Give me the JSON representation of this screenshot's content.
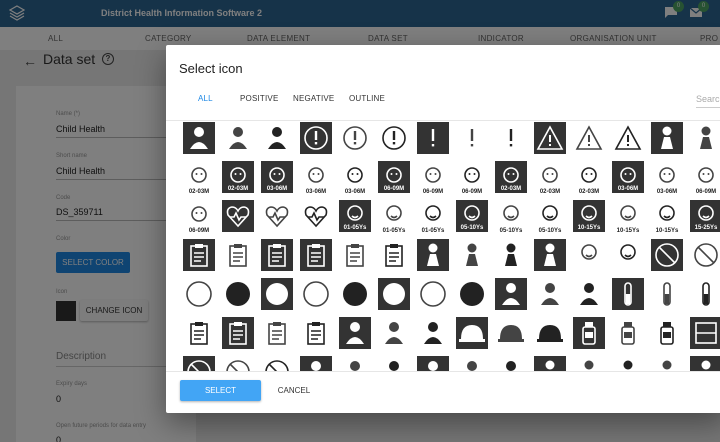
{
  "header": {
    "app_title": "District Health Information Software 2",
    "messages_badge": "0",
    "mail_badge": "0"
  },
  "nav": {
    "tabs": [
      "ALL",
      "CATEGORY",
      "DATA ELEMENT",
      "DATA SET",
      "INDICATOR",
      "ORGANISATION UNIT",
      "PRO"
    ]
  },
  "page": {
    "title": "Data set",
    "name_label": "Name (*)",
    "name_value": "Child Health",
    "short_name_label": "Short name",
    "short_name_value": "Child Health",
    "code_label": "Code",
    "code_value": "DS_359711",
    "color_label": "Color",
    "select_color_button": "SELECT COLOR",
    "icon_label": "Icon",
    "change_icon_button": "CHANGE ICON",
    "description_placeholder": "Description",
    "expiry_label": "Expiry days",
    "expiry_value": "0",
    "open_future_label": "Open future periods for data entry",
    "open_future_value": "0"
  },
  "dialog": {
    "title": "Select icon",
    "tabs": [
      {
        "label": "ALL",
        "active": true
      },
      {
        "label": "POSITIVE",
        "active": false
      },
      {
        "label": "NEGATIVE",
        "active": false
      },
      {
        "label": "OUTLINE",
        "active": false
      }
    ],
    "search_placeholder": "Search",
    "select_button": "SELECT",
    "cancel_button": "CANCEL",
    "icon_rows": [
      [
        {
          "name": "farmer-icon",
          "style": "dark",
          "glyph": "person"
        },
        {
          "name": "farmer-outline-icon",
          "style": "outline",
          "glyph": "person"
        },
        {
          "name": "farmer-positive-icon",
          "style": "plain",
          "glyph": "person"
        },
        {
          "name": "exclamation-circle-dark-icon",
          "style": "dark",
          "glyph": "excl-circle"
        },
        {
          "name": "exclamation-circle-outline-icon",
          "style": "outline",
          "glyph": "excl-circle"
        },
        {
          "name": "exclamation-circle-icon",
          "style": "plain",
          "glyph": "excl-circle"
        },
        {
          "name": "exclamation-dark-icon",
          "style": "dark",
          "glyph": "excl"
        },
        {
          "name": "exclamation-outline-icon",
          "style": "outline",
          "glyph": "excl"
        },
        {
          "name": "exclamation-icon",
          "style": "plain",
          "glyph": "excl"
        },
        {
          "name": "warning-dark-icon",
          "style": "dark",
          "glyph": "triangle"
        },
        {
          "name": "warning-outline-icon",
          "style": "outline",
          "glyph": "triangle"
        },
        {
          "name": "warning-icon",
          "style": "plain",
          "glyph": "triangle"
        },
        {
          "name": "pregnant-dark-icon",
          "style": "dark",
          "glyph": "woman"
        },
        {
          "name": "pregnant-outline-icon",
          "style": "outline",
          "glyph": "woman"
        }
      ],
      [
        {
          "name": "baby-02-03m-icon",
          "style": "outline",
          "glyph": "baby",
          "label": "02-03M"
        },
        {
          "name": "baby-02-03m-dark-icon",
          "style": "dark",
          "glyph": "baby",
          "label": "02-03M"
        },
        {
          "name": "baby-03-06m-dark-icon",
          "style": "dark",
          "glyph": "baby",
          "label": "03-06M"
        },
        {
          "name": "baby-03-06m-icon",
          "style": "outline",
          "glyph": "baby",
          "label": "03-06M"
        },
        {
          "name": "baby-03-06m-positive-icon",
          "style": "plain",
          "glyph": "baby",
          "label": "03-06M"
        },
        {
          "name": "baby-06-09m-dark-icon",
          "style": "dark",
          "glyph": "baby",
          "label": "06-09M"
        },
        {
          "name": "baby-06-09m-icon",
          "style": "outline",
          "glyph": "baby",
          "label": "06-09M"
        },
        {
          "name": "baby-06-09m-positive-icon",
          "style": "plain",
          "glyph": "baby",
          "label": "06-09M"
        },
        {
          "name": "baby-02-03m-dark-2-icon",
          "style": "dark",
          "glyph": "baby",
          "label": "02-03M"
        },
        {
          "name": "baby-02-03m-outline-2-icon",
          "style": "outline",
          "glyph": "baby",
          "label": "02-03M"
        },
        {
          "name": "baby-02-03m-positive-2-icon",
          "style": "plain",
          "glyph": "baby",
          "label": "02-03M"
        },
        {
          "name": "baby-03-06m-dark-2-icon",
          "style": "dark",
          "glyph": "baby",
          "label": "03-06M"
        },
        {
          "name": "baby-03-06m-outline-2-icon",
          "style": "outline",
          "glyph": "baby",
          "label": "03-06M"
        },
        {
          "name": "baby-06-09m-outline-2-icon",
          "style": "outline",
          "glyph": "baby",
          "label": "06-09M"
        }
      ],
      [
        {
          "name": "baby-06-09m-outline-3-icon",
          "style": "outline",
          "glyph": "baby",
          "label": "06-09M"
        },
        {
          "name": "heart-pulse-dark-icon",
          "style": "dark",
          "glyph": "heart"
        },
        {
          "name": "heart-check-outline-icon",
          "style": "outline",
          "glyph": "heart"
        },
        {
          "name": "heart-check-icon",
          "style": "plain",
          "glyph": "heart"
        },
        {
          "name": "child-01-05y-dark-icon",
          "style": "dark",
          "glyph": "child",
          "label": "01-05Ys"
        },
        {
          "name": "child-01-05y-icon",
          "style": "outline",
          "glyph": "child",
          "label": "01-05Ys"
        },
        {
          "name": "child-01-05y-positive-icon",
          "style": "plain",
          "glyph": "child",
          "label": "01-05Ys"
        },
        {
          "name": "child-05-10y-dark-icon",
          "style": "dark",
          "glyph": "child",
          "label": "05-10Ys"
        },
        {
          "name": "child-05-10y-icon",
          "style": "outline",
          "glyph": "child",
          "label": "05-10Ys"
        },
        {
          "name": "child-05-10y-positive-icon",
          "style": "plain",
          "glyph": "child",
          "label": "05-10Ys"
        },
        {
          "name": "child-10-15y-dark-icon",
          "style": "dark",
          "glyph": "child",
          "label": "10-15Ys"
        },
        {
          "name": "child-10-15y-icon",
          "style": "outline",
          "glyph": "child",
          "label": "10-15Ys"
        },
        {
          "name": "child-10-15y-positive-icon",
          "style": "plain",
          "glyph": "child",
          "label": "10-15Ys"
        },
        {
          "name": "child-15-25y-dark-icon",
          "style": "dark",
          "glyph": "child",
          "label": "15-25Ys"
        }
      ],
      [
        {
          "name": "clipboard-dark-icon",
          "style": "dark",
          "glyph": "clipboard"
        },
        {
          "name": "clipboard-outline-icon",
          "style": "outline",
          "glyph": "clipboard"
        },
        {
          "name": "clipboard-check-dark-icon",
          "style": "dark",
          "glyph": "clipboard"
        },
        {
          "name": "clipboard-list-dark-icon",
          "style": "dark",
          "glyph": "clipboard"
        },
        {
          "name": "clipboard-list-outline-icon",
          "style": "outline",
          "glyph": "clipboard"
        },
        {
          "name": "clipboard-list-icon",
          "style": "plain",
          "glyph": "clipboard"
        },
        {
          "name": "woman-dark-icon",
          "style": "dark",
          "glyph": "woman"
        },
        {
          "name": "woman-outline-icon",
          "style": "outline",
          "glyph": "woman"
        },
        {
          "name": "woman-icon",
          "style": "plain",
          "glyph": "woman"
        },
        {
          "name": "girl-dark-icon",
          "style": "dark",
          "glyph": "woman"
        },
        {
          "name": "children-outline-icon",
          "style": "outline",
          "glyph": "child"
        },
        {
          "name": "children-icon",
          "style": "plain",
          "glyph": "child"
        },
        {
          "name": "no-syringe-dark-icon",
          "style": "dark",
          "glyph": "no"
        },
        {
          "name": "no-syringe-outline-icon",
          "style": "outline",
          "glyph": "no"
        }
      ],
      [
        {
          "name": "circle-outline-large-icon",
          "style": "outline",
          "glyph": "circle-outline"
        },
        {
          "name": "circle-large-icon",
          "style": "plain",
          "glyph": "circle-filled"
        },
        {
          "name": "circle-dark-large-icon",
          "style": "dark",
          "glyph": "circle-white"
        },
        {
          "name": "circle-outline-medium-icon",
          "style": "outline",
          "glyph": "circle-outline"
        },
        {
          "name": "circle-medium-icon",
          "style": "plain",
          "glyph": "circle-filled"
        },
        {
          "name": "circle-dark-medium-icon",
          "style": "dark",
          "glyph": "circle-white"
        },
        {
          "name": "circle-outline-small-icon",
          "style": "outline",
          "glyph": "circle-outline"
        },
        {
          "name": "circle-small-icon",
          "style": "plain",
          "glyph": "circle-filled"
        },
        {
          "name": "worker-dark-icon",
          "style": "dark",
          "glyph": "person"
        },
        {
          "name": "worker-outline-icon",
          "style": "outline",
          "glyph": "person"
        },
        {
          "name": "worker-icon",
          "style": "plain",
          "glyph": "person"
        },
        {
          "name": "test-tube-dark-icon",
          "style": "dark",
          "glyph": "tube"
        },
        {
          "name": "test-tube-outline-icon",
          "style": "outline",
          "glyph": "tube"
        },
        {
          "name": "test-tube-icon",
          "style": "plain",
          "glyph": "tube"
        }
      ],
      [
        {
          "name": "clipboard-pen-icon",
          "style": "plain",
          "glyph": "clipboard"
        },
        {
          "name": "clipboard-pen-dark-icon",
          "style": "dark",
          "glyph": "clipboard"
        },
        {
          "name": "clipboard-pen-outline-icon",
          "style": "outline",
          "glyph": "clipboard"
        },
        {
          "name": "clipboard-edit-icon",
          "style": "plain",
          "glyph": "clipboard"
        },
        {
          "name": "construction-worker-dark-icon",
          "style": "dark",
          "glyph": "person"
        },
        {
          "name": "construction-worker-outline-icon",
          "style": "outline",
          "glyph": "person"
        },
        {
          "name": "construction-worker-icon",
          "style": "plain",
          "glyph": "person"
        },
        {
          "name": "helmet-dark-icon",
          "style": "dark",
          "glyph": "helmet"
        },
        {
          "name": "helmet-outline-icon",
          "style": "outline",
          "glyph": "helmet"
        },
        {
          "name": "helmet-icon",
          "style": "plain",
          "glyph": "helmet"
        },
        {
          "name": "medicine-bottle-dark-icon",
          "style": "dark",
          "glyph": "bottle"
        },
        {
          "name": "medicine-bottle-outline-icon",
          "style": "outline",
          "glyph": "bottle"
        },
        {
          "name": "medicine-bottle-icon",
          "style": "plain",
          "glyph": "bottle"
        },
        {
          "name": "cabinet-dark-icon",
          "style": "dark",
          "glyph": "cabinet"
        }
      ],
      [
        {
          "name": "no-entry-dark-icon",
          "style": "dark",
          "glyph": "no"
        },
        {
          "name": "no-entry-outline-icon",
          "style": "outline",
          "glyph": "no"
        },
        {
          "name": "no-entry-icon",
          "style": "plain",
          "glyph": "no"
        },
        {
          "name": "well-dark-icon",
          "style": "dark",
          "glyph": "person"
        },
        {
          "name": "well-outline-icon",
          "style": "outline",
          "glyph": "person"
        },
        {
          "name": "well-icon",
          "style": "plain",
          "glyph": "person"
        },
        {
          "name": "doctor-dark-icon",
          "style": "dark",
          "glyph": "person"
        },
        {
          "name": "doctor-outline-icon",
          "style": "outline",
          "glyph": "person"
        },
        {
          "name": "doctor-icon",
          "style": "plain",
          "glyph": "person"
        },
        {
          "name": "nurse-dark-icon",
          "style": "dark",
          "glyph": "woman"
        },
        {
          "name": "nurse-outline-icon",
          "style": "outline",
          "glyph": "woman"
        },
        {
          "name": "nurse-icon",
          "style": "plain",
          "glyph": "woman"
        },
        {
          "name": "mother-outline-icon",
          "style": "outline",
          "glyph": "woman"
        },
        {
          "name": "mother-dark-icon",
          "style": "dark",
          "glyph": "woman"
        }
      ]
    ]
  },
  "colors": {
    "header": "#2c6693",
    "accent": "#1e88e5",
    "select_button": "#42a5f5",
    "badge": "#4ea564",
    "icon_dark": "#333333"
  }
}
